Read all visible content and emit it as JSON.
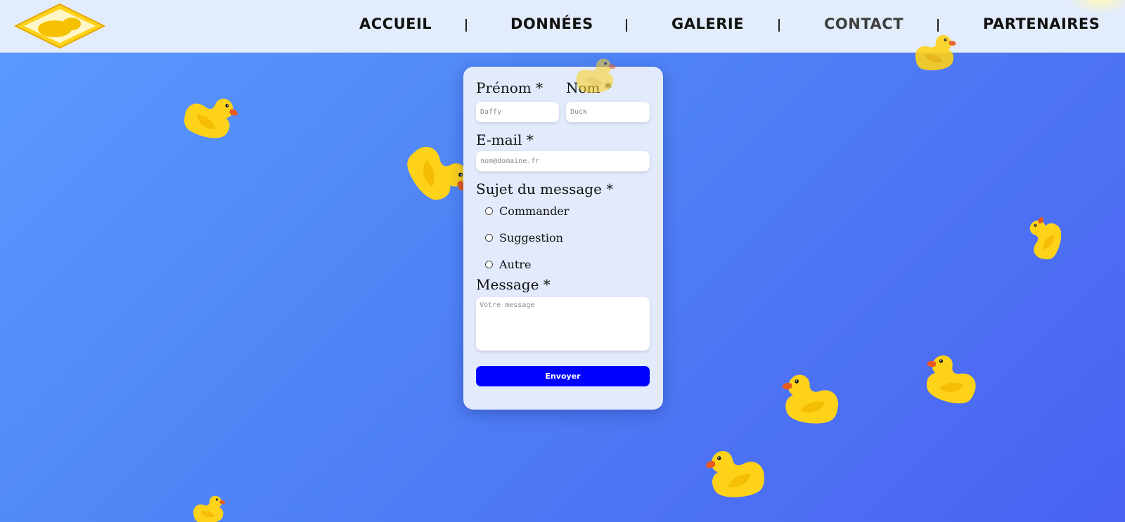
{
  "header": {
    "logo_name": "duck-logo",
    "nav": [
      {
        "label": "ACCUEIL"
      },
      {
        "label": "DONNÉES"
      },
      {
        "label": "GALERIE"
      },
      {
        "label": "CONTACT"
      },
      {
        "label": "PARTENAIRES"
      }
    ]
  },
  "form": {
    "firstname": {
      "label": "Prénom *",
      "placeholder": "Daffy"
    },
    "lastname": {
      "label": "Nom *",
      "placeholder": "Duck"
    },
    "email": {
      "label": "E-mail *",
      "placeholder": "nom@domaine.fr"
    },
    "subject": {
      "label": "Sujet du message *",
      "options": [
        "Commander",
        "Suggestion",
        "Autre"
      ]
    },
    "message": {
      "label": "Message *",
      "placeholder": "Votre message"
    },
    "submit_label": "Envoyer"
  },
  "colors": {
    "accent_button": "#0000ff",
    "duck_body": "#ffd21a",
    "duck_beak": "#e85a1c",
    "background": "#4f82f5"
  }
}
